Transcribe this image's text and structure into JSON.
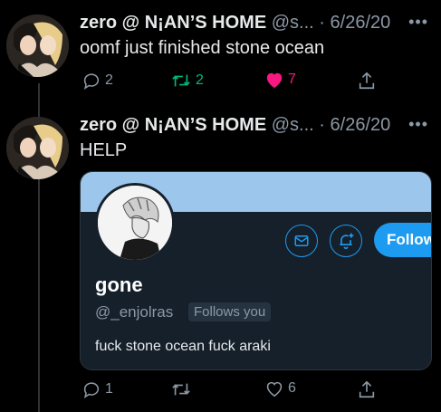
{
  "tweets": [
    {
      "display_name": "zero @ N¡AN’S HOME",
      "handle": "@s...",
      "separator": "·",
      "date": "6/26/20",
      "text": "oomf just finished stone ocean",
      "reply_count": "2",
      "retweet_count": "2",
      "like_count": "7",
      "liked": true,
      "retweeted": true
    },
    {
      "display_name": "zero @ N¡AN’S HOME",
      "handle": "@s...",
      "separator": "·",
      "date": "6/26/20",
      "text": "HELP",
      "reply_count": "1",
      "retweet_count": "",
      "like_count": "6",
      "liked": false,
      "retweeted": false
    }
  ],
  "more_glyph": "•••",
  "profile_card": {
    "name": "gone",
    "handle": "@_enjolras",
    "follows_you": "Follows you",
    "bio": "fuck stone ocean fuck araki",
    "follow_label": "Follow"
  },
  "colors": {
    "accent": "#1d9bf0",
    "like": "#f91880",
    "retweet": "#00ba7c",
    "banner": "#9cc6ec"
  }
}
